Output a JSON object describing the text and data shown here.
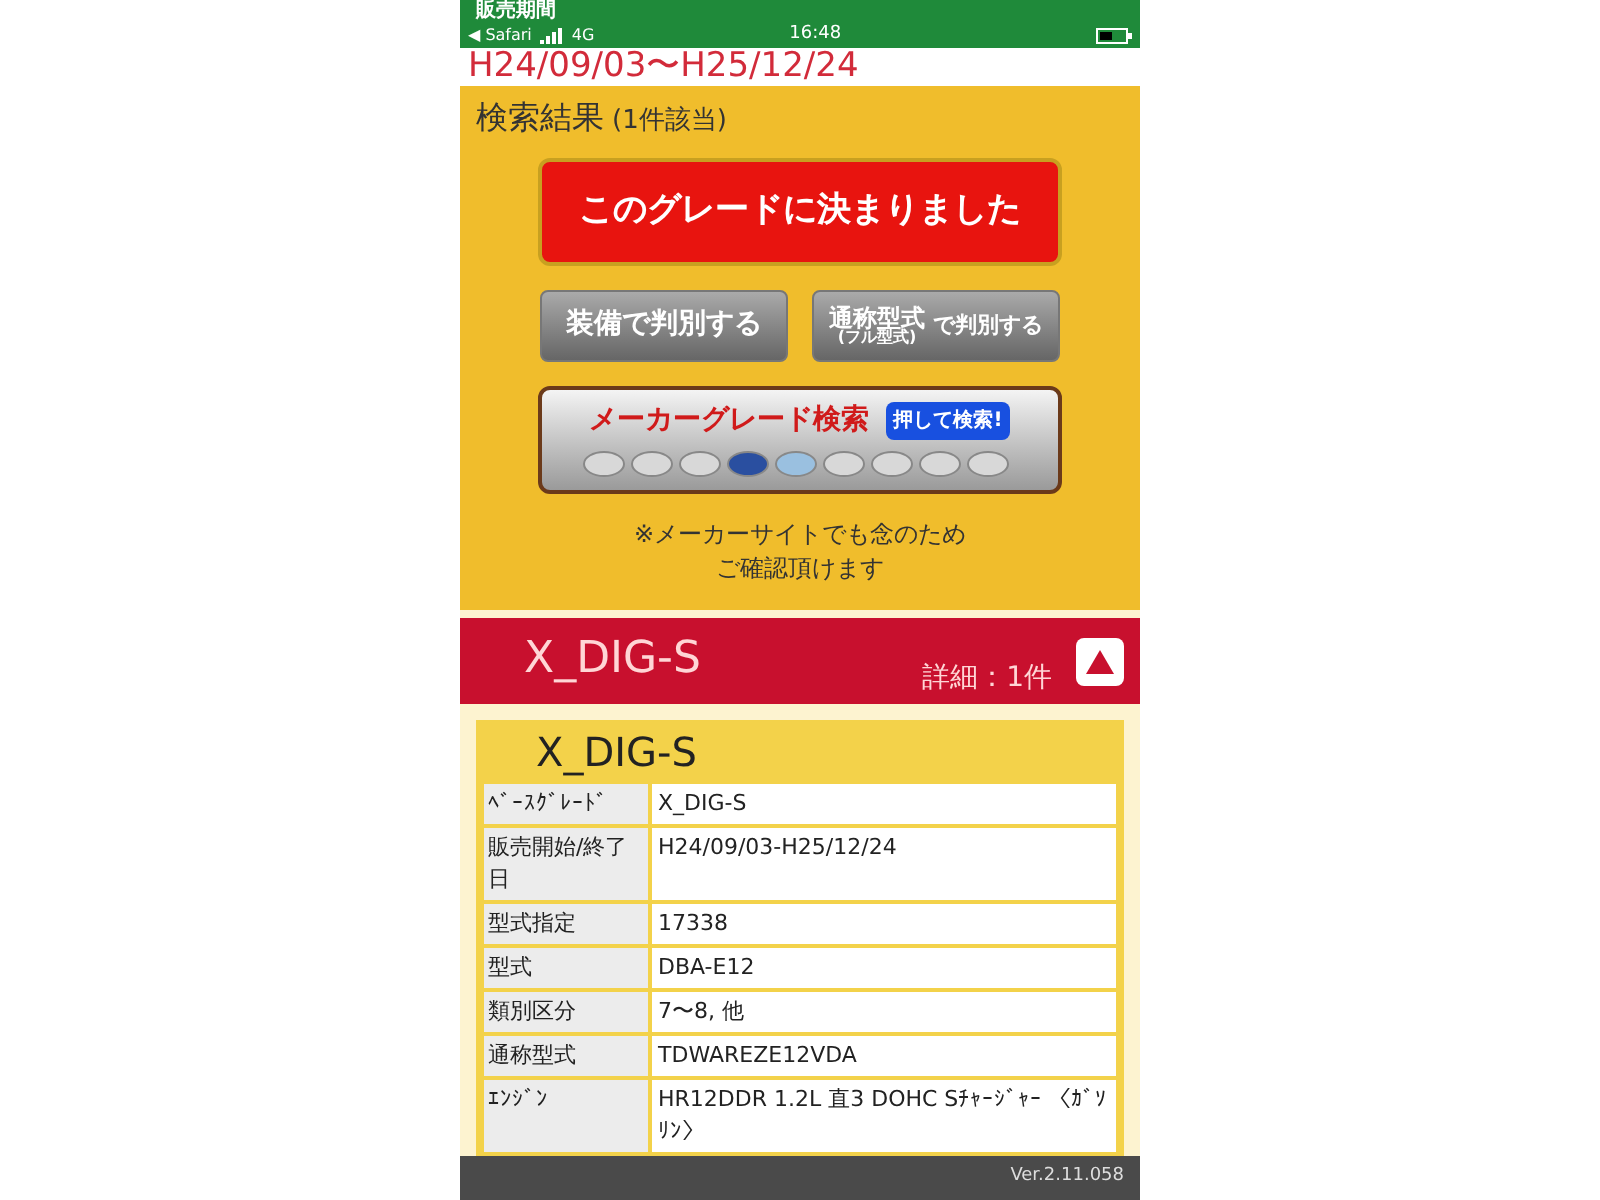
{
  "status_bar": {
    "back": "◀ Safari",
    "network": "4G",
    "time": "16:48"
  },
  "header": {
    "title": "販売期間"
  },
  "period": "H24/09/03〜H25/12/24",
  "results": {
    "title": "検索結果",
    "count": "(1件該当)"
  },
  "confirm_button": "このグレードに決まりました",
  "buttons": [
    {
      "kind": "plain",
      "label": "装備で判別する"
    },
    {
      "kind": "stacked",
      "label": "通称型式",
      "sub": "(フル型式)",
      "tail": "で判別する"
    }
  ],
  "maker_search": {
    "title": "メーカーグレード検索",
    "button": "押して検索!"
  },
  "note": [
    "※メーカーサイトでも念のため",
    "ご確認頂けます"
  ],
  "grade": {
    "name": "X_DIG-S",
    "detail": "詳細：1件",
    "expanded": true
  },
  "spec": {
    "title": "X_DIG-S",
    "rows": [
      {
        "label": "ﾍﾞｰｽｸﾞﾚｰﾄﾞ",
        "value": "X_DIG-S"
      },
      {
        "label": "販売開始/終了日",
        "value": "H24/09/03-H25/12/24"
      },
      {
        "label": "型式指定",
        "value": "17338"
      },
      {
        "label": "型式",
        "value": "DBA-E12"
      },
      {
        "label": "類別区分",
        "value": "7〜8, 他"
      },
      {
        "label": "通称型式",
        "value": "TDWAREZE12VDA"
      },
      {
        "label": "ｴﾝｼﾞﾝ",
        "value": "HR12DDR 1.2L 直3 DOHC Sﾁｬｰｼﾞｬｰ 〈ｶﾞｿﾘﾝ〉"
      }
    ]
  },
  "footer": {
    "version": "Ver.2.11.058"
  }
}
